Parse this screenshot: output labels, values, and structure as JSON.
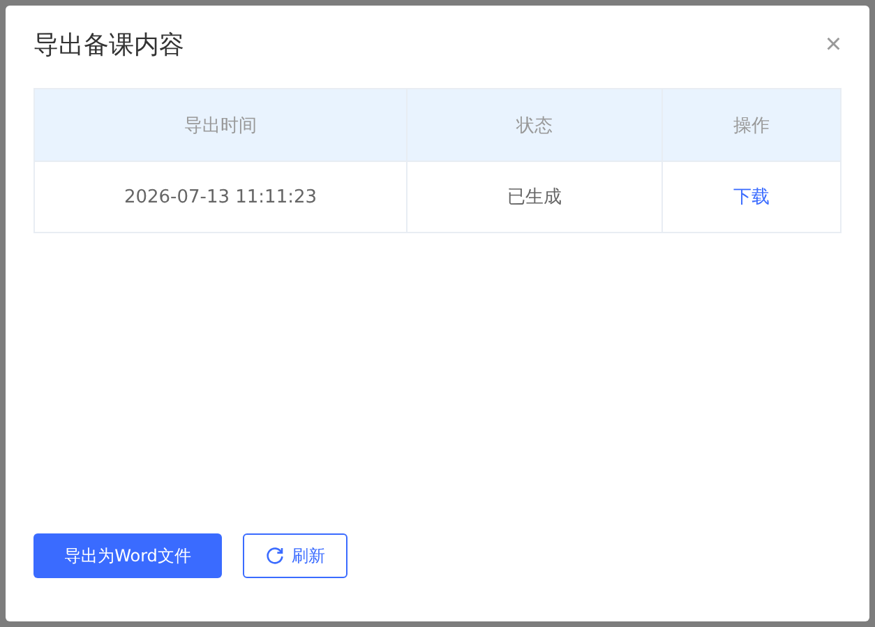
{
  "dialog": {
    "title": "导出备课内容",
    "close": "×"
  },
  "table": {
    "columns": [
      "导出时间",
      "状态",
      "操作"
    ],
    "rows": [
      {
        "time": "2026-07-13 11:11:23",
        "status": "已生成",
        "action": "下载"
      }
    ]
  },
  "buttons": [
    {
      "kind": "primary",
      "label": "导出为Word文件"
    },
    {
      "kind": "refresh",
      "label": "刷新"
    }
  ]
}
